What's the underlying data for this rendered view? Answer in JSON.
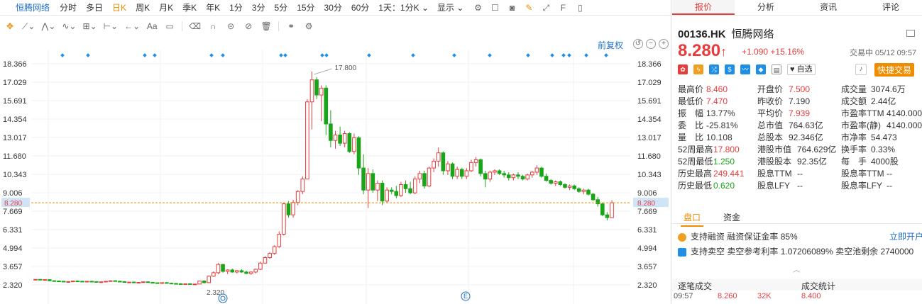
{
  "toolbar": {
    "stock_name": "恒腾网络",
    "periods": [
      "分时",
      "多日",
      "日K",
      "周K",
      "月K",
      "季K",
      "年K",
      "1分",
      "3分",
      "5分",
      "15分",
      "30分",
      "60分"
    ],
    "active_period": "日K",
    "range_select": "1天：1分K",
    "display_label": "显示"
  },
  "chart": {
    "adjust_label": "前复权",
    "high_marker": "17.800",
    "low_marker": "2.320",
    "current_price_label": "8.280",
    "event_marker": "E"
  },
  "chart_data": {
    "type": "candlestick",
    "y_ticks": [
      "18.366",
      "17.029",
      "15.691",
      "14.354",
      "13.017",
      "11.680",
      "10.343",
      "9.006",
      "7.669",
      "6.331",
      "4.994",
      "3.657",
      "2.320"
    ],
    "ylim": [
      2.32,
      18.366
    ],
    "current_price": 8.28,
    "candles": [
      [
        2.7,
        2.72,
        2.65,
        2.72
      ],
      [
        2.72,
        2.74,
        2.66,
        2.68
      ],
      [
        2.68,
        2.72,
        2.64,
        2.7
      ],
      [
        2.7,
        2.71,
        2.6,
        2.62
      ],
      [
        2.62,
        2.66,
        2.55,
        2.6
      ],
      [
        2.6,
        2.64,
        2.55,
        2.58
      ],
      [
        2.58,
        2.6,
        2.5,
        2.53
      ],
      [
        2.53,
        2.58,
        2.48,
        2.56
      ],
      [
        2.56,
        2.62,
        2.52,
        2.6
      ],
      [
        2.6,
        2.64,
        2.55,
        2.58
      ],
      [
        2.58,
        2.62,
        2.52,
        2.55
      ],
      [
        2.55,
        2.6,
        2.5,
        2.58
      ],
      [
        2.58,
        2.62,
        2.52,
        2.56
      ],
      [
        2.56,
        2.58,
        2.48,
        2.52
      ],
      [
        2.52,
        2.56,
        2.46,
        2.54
      ],
      [
        2.54,
        2.6,
        2.5,
        2.58
      ],
      [
        2.58,
        2.64,
        2.54,
        2.62
      ],
      [
        2.62,
        2.66,
        2.56,
        2.58
      ],
      [
        2.58,
        2.62,
        2.52,
        2.55
      ],
      [
        2.55,
        2.58,
        2.48,
        2.5
      ],
      [
        2.5,
        2.54,
        2.44,
        2.52
      ],
      [
        2.52,
        2.56,
        2.46,
        2.48
      ],
      [
        2.48,
        2.52,
        2.42,
        2.5
      ],
      [
        2.5,
        2.56,
        2.46,
        2.54
      ],
      [
        2.54,
        2.58,
        2.48,
        2.5
      ],
      [
        2.5,
        2.54,
        2.44,
        2.47
      ],
      [
        2.47,
        2.5,
        2.4,
        2.45
      ],
      [
        2.45,
        2.5,
        2.4,
        2.48
      ],
      [
        2.48,
        2.52,
        2.42,
        2.44
      ],
      [
        2.44,
        2.48,
        2.38,
        2.42
      ],
      [
        2.42,
        2.46,
        2.36,
        2.4
      ],
      [
        2.4,
        2.44,
        2.34,
        2.38
      ],
      [
        2.38,
        2.42,
        2.32,
        2.4
      ],
      [
        2.4,
        2.44,
        2.34,
        2.36
      ],
      [
        2.36,
        2.4,
        2.32,
        2.38
      ],
      [
        2.38,
        2.62,
        2.36,
        2.6
      ],
      [
        2.6,
        2.66,
        2.42,
        2.48
      ],
      [
        2.48,
        3.0,
        2.44,
        2.95
      ],
      [
        2.95,
        3.3,
        2.9,
        3.2
      ],
      [
        3.2,
        3.9,
        3.1,
        3.8
      ],
      [
        3.8,
        3.85,
        3.2,
        3.3
      ],
      [
        3.3,
        3.45,
        3.1,
        3.4
      ],
      [
        3.4,
        3.5,
        3.2,
        3.25
      ],
      [
        3.25,
        3.4,
        3.15,
        3.35
      ],
      [
        3.35,
        3.45,
        3.2,
        3.25
      ],
      [
        3.25,
        3.35,
        3.1,
        3.15
      ],
      [
        3.15,
        3.3,
        3.05,
        3.25
      ],
      [
        3.25,
        3.5,
        3.15,
        3.45
      ],
      [
        3.45,
        4.0,
        3.4,
        3.9
      ],
      [
        3.9,
        4.4,
        3.85,
        4.3
      ],
      [
        4.3,
        4.7,
        4.2,
        4.6
      ],
      [
        4.6,
        5.2,
        4.5,
        5.1
      ],
      [
        5.1,
        6.2,
        5.0,
        6.0
      ],
      [
        6.0,
        8.3,
        5.9,
        8.2
      ],
      [
        8.2,
        8.4,
        7.2,
        7.4
      ],
      [
        7.4,
        8.5,
        7.2,
        8.3
      ],
      [
        8.3,
        9.2,
        8.1,
        9.1
      ],
      [
        9.1,
        10.2,
        8.9,
        10.0
      ],
      [
        10.0,
        15.8,
        10.0,
        15.6
      ],
      [
        15.6,
        17.8,
        13.6,
        17.2
      ],
      [
        17.2,
        17.4,
        15.8,
        16.1
      ],
      [
        16.1,
        16.8,
        14.2,
        16.6
      ],
      [
        16.6,
        16.8,
        13.2,
        14.0
      ],
      [
        14.0,
        15.0,
        12.3,
        12.8
      ],
      [
        12.8,
        13.5,
        12.2,
        13.2
      ],
      [
        13.2,
        13.8,
        12.4,
        12.6
      ],
      [
        12.6,
        13.5,
        12.3,
        13.3
      ],
      [
        13.3,
        13.4,
        11.9,
        12.0
      ],
      [
        12.0,
        13.3,
        11.8,
        13.0
      ],
      [
        13.0,
        13.1,
        10.3,
        10.8
      ],
      [
        10.8,
        11.8,
        8.9,
        9.2
      ],
      [
        9.2,
        10.8,
        7.9,
        10.4
      ],
      [
        10.4,
        10.7,
        9.0,
        9.2
      ],
      [
        9.2,
        9.9,
        8.4,
        9.7
      ],
      [
        9.7,
        9.9,
        8.1,
        8.4
      ],
      [
        8.4,
        9.4,
        8.3,
        9.2
      ],
      [
        9.2,
        9.4,
        8.9,
        9.1
      ],
      [
        9.1,
        9.5,
        8.6,
        8.8
      ],
      [
        8.8,
        9.8,
        8.7,
        9.6
      ],
      [
        9.6,
        9.9,
        9.0,
        9.3
      ],
      [
        9.3,
        9.8,
        8.9,
        9.0
      ],
      [
        9.0,
        10.2,
        8.9,
        10.0
      ],
      [
        10.0,
        10.6,
        9.7,
        10.4
      ],
      [
        10.4,
        10.6,
        9.3,
        9.5
      ],
      [
        9.5,
        10.9,
        9.4,
        10.8
      ],
      [
        10.8,
        11.5,
        10.5,
        11.3
      ],
      [
        11.3,
        12.3,
        10.9,
        11.9
      ],
      [
        11.9,
        12.0,
        10.3,
        10.6
      ],
      [
        10.6,
        11.3,
        10.3,
        11.1
      ],
      [
        11.1,
        11.2,
        10.0,
        10.2
      ],
      [
        10.2,
        10.9,
        10.0,
        10.7
      ],
      [
        10.7,
        10.8,
        10.0,
        10.2
      ],
      [
        10.2,
        10.8,
        10.0,
        10.6
      ],
      [
        10.6,
        11.4,
        10.5,
        11.2
      ],
      [
        11.2,
        11.6,
        10.9,
        11.4
      ],
      [
        11.4,
        11.5,
        10.2,
        10.4
      ],
      [
        10.4,
        10.6,
        9.4,
        10.0
      ],
      [
        10.0,
        10.6,
        9.8,
        10.5
      ],
      [
        10.5,
        10.7,
        10.3,
        10.6
      ],
      [
        10.6,
        10.7,
        10.3,
        10.4
      ],
      [
        10.4,
        10.6,
        10.1,
        10.3
      ],
      [
        10.3,
        10.5,
        9.9,
        10.1
      ],
      [
        10.1,
        10.4,
        9.9,
        10.3
      ],
      [
        10.3,
        10.5,
        10.0,
        10.2
      ],
      [
        10.2,
        10.3,
        9.9,
        10.0
      ],
      [
        10.0,
        10.4,
        9.9,
        10.3
      ],
      [
        10.3,
        10.6,
        10.1,
        10.5
      ],
      [
        10.5,
        11.0,
        10.3,
        10.8
      ],
      [
        10.8,
        10.9,
        10.1,
        10.2
      ],
      [
        10.2,
        10.4,
        9.8,
        9.9
      ],
      [
        9.9,
        10.0,
        9.6,
        9.7
      ],
      [
        9.7,
        9.9,
        9.5,
        9.8
      ],
      [
        9.8,
        9.9,
        9.5,
        9.6
      ],
      [
        9.6,
        9.7,
        9.3,
        9.4
      ],
      [
        9.4,
        9.6,
        9.2,
        9.5
      ],
      [
        9.5,
        9.6,
        9.2,
        9.3
      ],
      [
        9.3,
        9.4,
        9.0,
        9.1
      ],
      [
        9.1,
        9.3,
        8.9,
        9.2
      ],
      [
        9.2,
        9.3,
        8.8,
        8.9
      ],
      [
        8.9,
        9.0,
        8.4,
        8.5
      ],
      [
        8.5,
        8.7,
        8.0,
        8.2
      ],
      [
        8.2,
        8.3,
        7.3,
        7.4
      ],
      [
        7.4,
        7.6,
        7.0,
        7.2
      ],
      [
        7.2,
        8.46,
        7.2,
        8.28
      ]
    ]
  },
  "quote": {
    "code": "00136.HK",
    "name": "恒腾网络",
    "price": "8.280",
    "arrow": "↑",
    "change": "+1.090",
    "change_pct": "+15.16%",
    "status": "交易中 05/12 09:57",
    "tabs": [
      "报价",
      "分析",
      "资讯",
      "评论"
    ],
    "watch_label": "自选",
    "fast_trade": "快捷交易",
    "rows": [
      [
        [
          "最高价",
          "8.460",
          "red"
        ],
        [
          "开盘价",
          "7.500",
          "red"
        ],
        [
          "成交量",
          "3074.6万",
          ""
        ]
      ],
      [
        [
          "最低价",
          "7.470",
          "red"
        ],
        [
          "昨收价",
          "7.190",
          ""
        ],
        [
          "成交额",
          "2.44亿",
          ""
        ]
      ],
      [
        [
          "振　幅",
          "13.77%",
          ""
        ],
        [
          "平均价",
          "7.939",
          "red"
        ],
        [
          "市盈率TTM",
          "4140.000",
          ""
        ]
      ],
      [
        [
          "委　比",
          "-25.81%",
          ""
        ],
        [
          "总市值",
          "764.63亿",
          ""
        ],
        [
          "市盈率(静)",
          "4140.000",
          ""
        ]
      ],
      [
        [
          "量　比",
          "10.108",
          ""
        ],
        [
          "总股本",
          "92.346亿",
          ""
        ],
        [
          "市净率",
          "54.473",
          ""
        ]
      ],
      [
        [
          "52周最高",
          "17.800",
          "red"
        ],
        [
          "港股市值",
          "764.629亿",
          ""
        ],
        [
          "换手率",
          "0.33%",
          ""
        ]
      ],
      [
        [
          "52周最低",
          "1.250",
          "grn"
        ],
        [
          "港股股本",
          "92.35亿",
          ""
        ],
        [
          "每　手",
          "4000股",
          ""
        ]
      ],
      [
        [
          "历史最高",
          "249.441",
          "red"
        ],
        [
          "股息TTM",
          "--",
          ""
        ],
        [
          "股息率TTM",
          "--",
          ""
        ]
      ],
      [
        [
          "历史最低",
          "0.620",
          "grn"
        ],
        [
          "股息LFY",
          "--",
          ""
        ],
        [
          "股息率LFY",
          "--",
          ""
        ]
      ]
    ]
  },
  "panel": {
    "tabs": [
      "盘口",
      "资金"
    ],
    "margin_label": "支持融资",
    "margin_text": "融资保证金率 85%",
    "open_account": "立即开户",
    "short_label": "支持卖空",
    "short_text": "卖空参考利率 1.07206089%",
    "short_pool": "卖空池剩余 2740000",
    "tick_title": "逐笔成交",
    "tick_stats": "成交统计",
    "tick_time": "09:57",
    "tick_price": "8.260",
    "tick_vol": "32K",
    "tick_stat_val": "8.400"
  },
  "colors": {
    "up": "#e63c3c",
    "down": "#19a519",
    "accent": "#f08c00",
    "link": "#1e6fc5"
  }
}
